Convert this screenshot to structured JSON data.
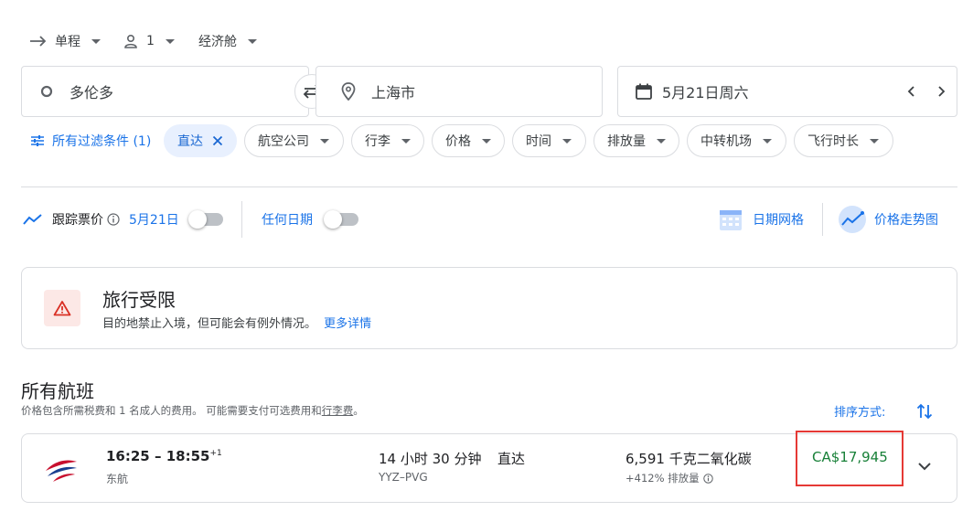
{
  "trip_options": {
    "trip_type": "单程",
    "passengers": "1",
    "cabin": "经济舱"
  },
  "search": {
    "origin": "多伦多",
    "destination": "上海市",
    "date": "5月21日周六"
  },
  "filters": {
    "all_filters": "所有过滤条件 (1)",
    "chips": [
      "直达",
      "航空公司",
      "行李",
      "价格",
      "时间",
      "排放量",
      "中转机场",
      "飞行时长"
    ]
  },
  "tracking": {
    "track_label": "跟踪票价",
    "date_label": "5月21日",
    "any_dates_label": "任何日期",
    "date_grid": "日期网格",
    "price_graph": "价格走势图"
  },
  "restriction": {
    "title": "旅行受限",
    "body": "目的地禁止入境，但可能会有例外情况。",
    "link": "更多详情"
  },
  "results": {
    "heading": "所有航班",
    "note_prefix": "价格包含所需税费和 1 名成人的费用。 可能需要支付可选费用和",
    "note_link": "行李费",
    "note_suffix": "。",
    "sort_label": "排序方式:"
  },
  "flight": {
    "times": "16:25 – 18:55",
    "day_offset": "+1",
    "airline": "东航",
    "duration": "14 小时 30 分钟",
    "route": "YYZ–PVG",
    "stops": "直达",
    "emissions": "6,591 千克二氧化碳",
    "emissions_delta": "+412% 排放量",
    "price": "CA$17,945"
  },
  "colors": {
    "accent": "#1a73e8",
    "price_green": "#188038",
    "warning_red": "#d93025",
    "highlight_red": "#e53935"
  }
}
